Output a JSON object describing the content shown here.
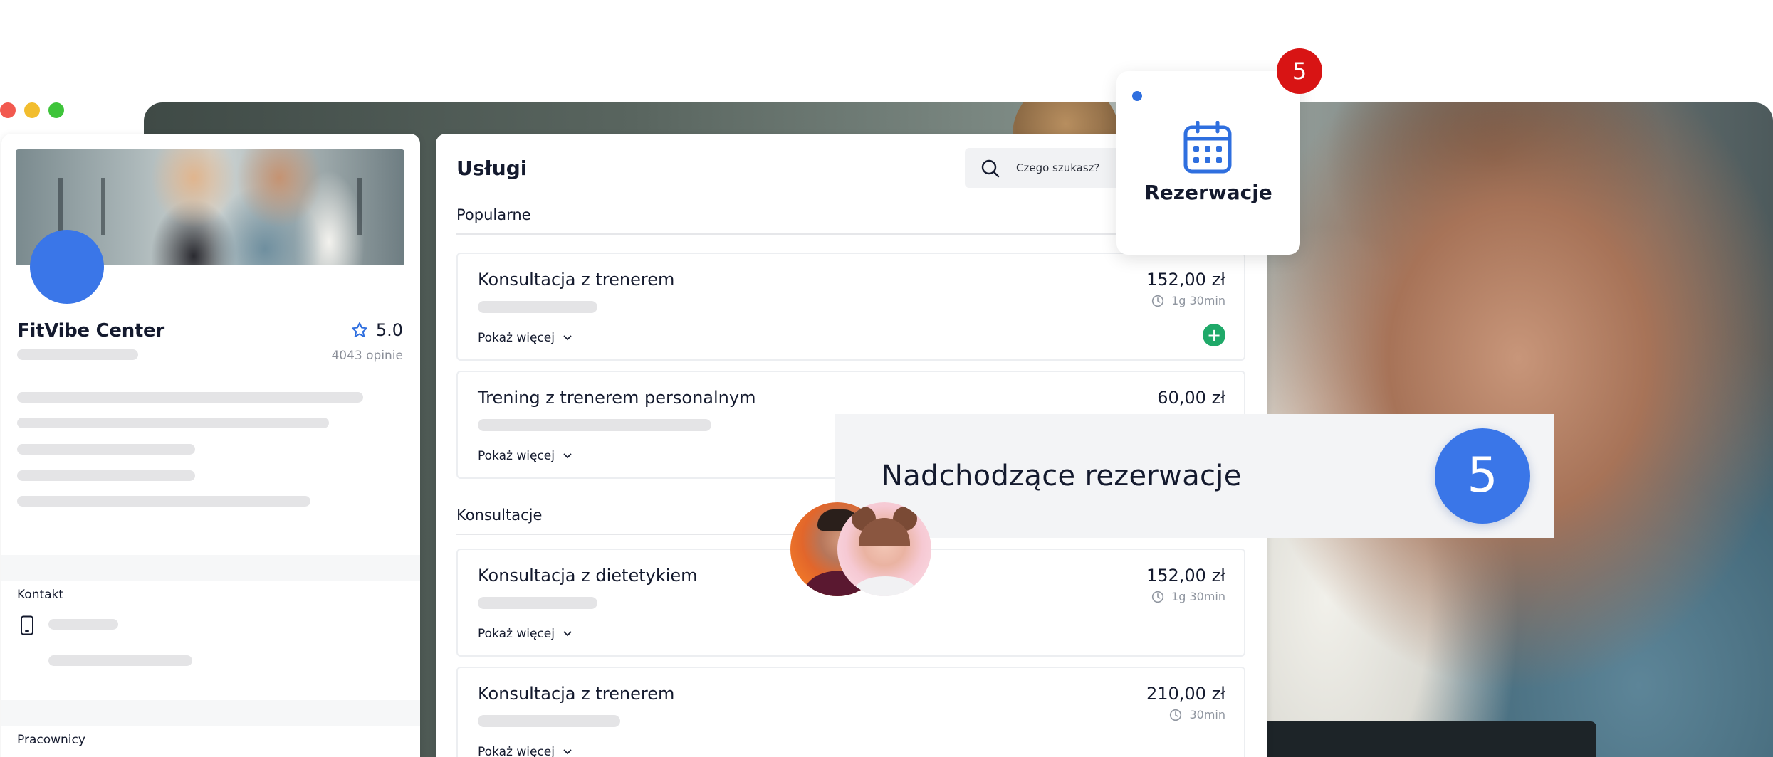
{
  "window": {
    "controls": [
      "close",
      "minimize",
      "maximize"
    ]
  },
  "profile": {
    "name": "FitVibe Center",
    "rating": "5.0",
    "reviews": "4043 opinie",
    "sections": {
      "contact": "Kontakt",
      "staff": "Pracownicy"
    },
    "icons": {
      "rating": "star-icon",
      "contact": "phone-icon"
    }
  },
  "services": {
    "title": "Usługi",
    "search_placeholder": "Czego szukasz?",
    "show_more_label": "Pokaż więcej",
    "categories": [
      {
        "name": "Popularne",
        "items": [
          {
            "name": "Konsultacja z trenerem",
            "price": "152,00 zł",
            "duration": "1g 30min",
            "has_add": true
          },
          {
            "name": "Trening z trenerem personalnym",
            "price": "60,00 zł",
            "duration": "",
            "has_add": false
          }
        ]
      },
      {
        "name": "Konsultacje",
        "items": [
          {
            "name": "Konsultacja z dietetykiem",
            "price": "152,00 zł",
            "duration": "1g 30min",
            "has_add": false
          },
          {
            "name": "Konsultacja z trenerem",
            "price": "210,00 zł",
            "duration": "30min",
            "has_add": false
          }
        ]
      }
    ]
  },
  "reservations": {
    "label": "Rezerwacje",
    "badge": "5",
    "icon": "calendar-icon"
  },
  "upcoming": {
    "title": "Nadchodzące rezerwacje",
    "count": "5"
  },
  "colors": {
    "accent": "#3a76e8",
    "badge": "#d81414",
    "add": "#1fa969"
  }
}
